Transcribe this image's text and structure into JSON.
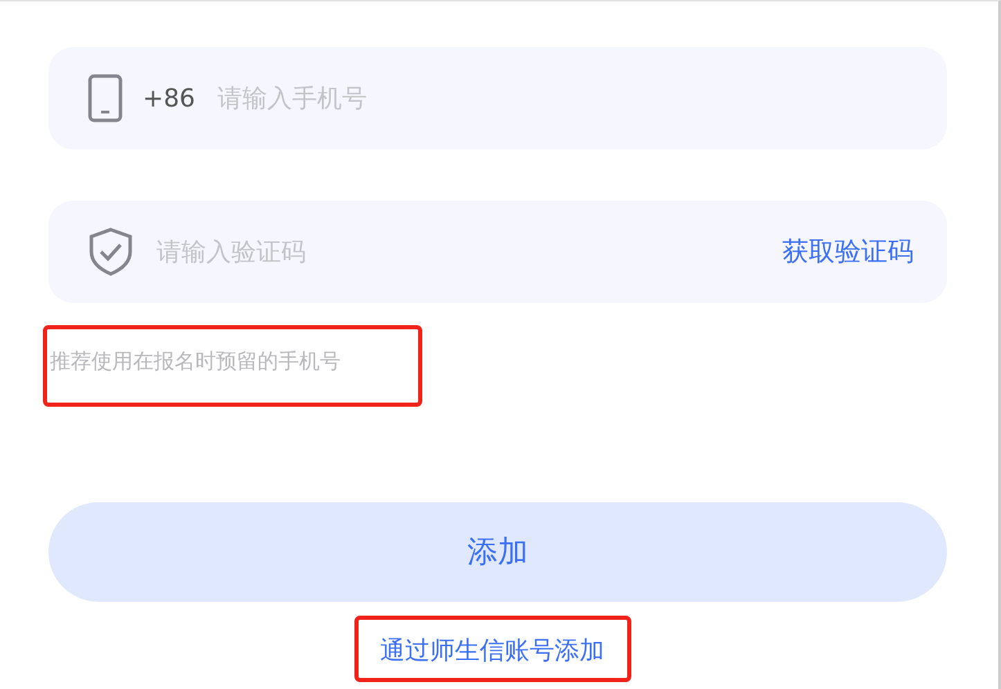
{
  "phone_field": {
    "prefix": "+86",
    "placeholder": "请输入手机号"
  },
  "code_field": {
    "placeholder": "请输入验证码",
    "action": "获取验证码"
  },
  "hint": {
    "text": "推荐使用在报名时预留的手机号",
    "highlighted": true
  },
  "submit_button": {
    "label": "添加"
  },
  "alt_link": {
    "label": "通过师生信账号添加",
    "highlighted": true
  }
}
